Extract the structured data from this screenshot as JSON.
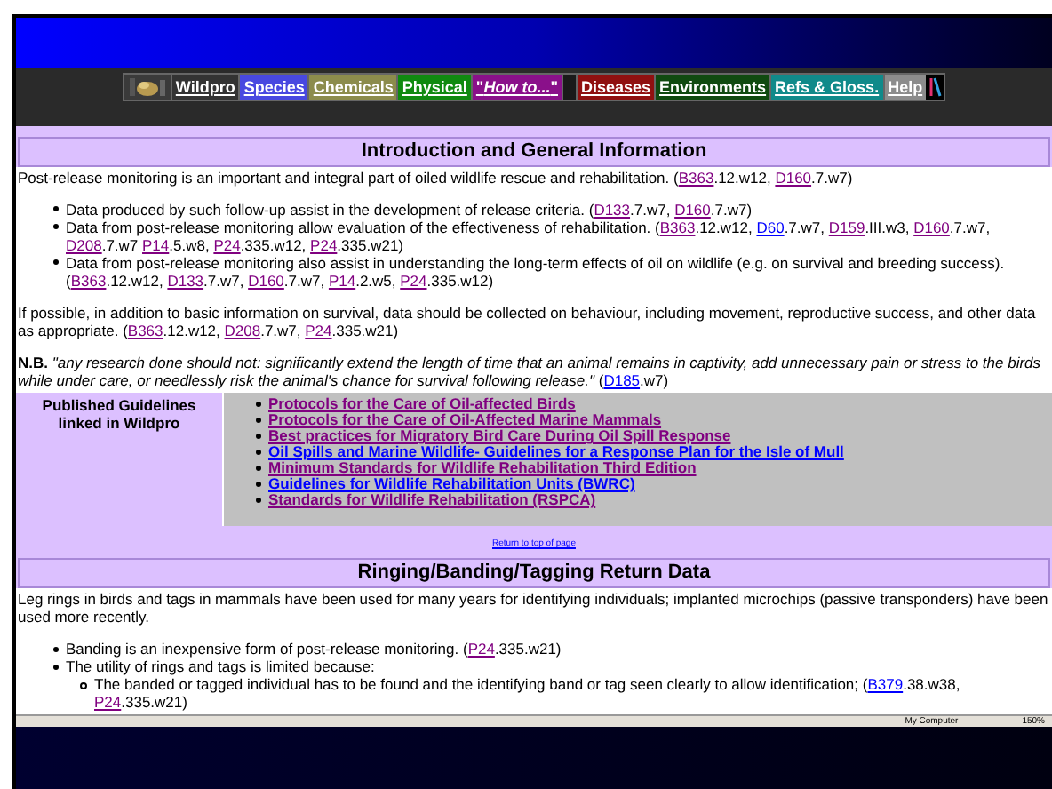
{
  "nav": [
    {
      "kind": "logo"
    },
    {
      "kind": "item",
      "label": "Wildpro",
      "color": "#333333"
    },
    {
      "kind": "item",
      "label": "Species",
      "color": "#4848e0"
    },
    {
      "kind": "item",
      "label": "Chemicals",
      "color": "#8c8c4c"
    },
    {
      "kind": "item",
      "label": "Physical",
      "color": "#108a10"
    },
    {
      "kind": "item",
      "label": "\"*How to...*\"",
      "color": "#8a108a"
    },
    {
      "kind": "gap"
    },
    {
      "kind": "item",
      "label": "Diseases",
      "color": "#901010"
    },
    {
      "kind": "item",
      "label": "Environments",
      "color": "#104a10"
    },
    {
      "kind": "item",
      "label": "Refs & Gloss.",
      "color": "#108a8a"
    },
    {
      "kind": "item",
      "label": "Help",
      "color": "#8c8c8c"
    },
    {
      "kind": "emblem"
    }
  ],
  "intro": {
    "heading": "Introduction and General Information",
    "blocks": [
      {
        "kind": "para",
        "parts": [
          {
            "kind": "text",
            "text": "Post-release monitoring is an important and integral part of oiled wildlife rescue and rehabilitation. ("
          },
          {
            "kind": "link",
            "text": "B363",
            "visited": true
          },
          {
            "kind": "text",
            "text": ".12.w12, "
          },
          {
            "kind": "link",
            "text": "D160",
            "visited": true
          },
          {
            "kind": "text",
            "text": ".7.w7)"
          }
        ]
      },
      {
        "kind": "list",
        "items": [
          {
            "parts": [
              {
                "kind": "text",
                "text": "Data produced by such follow-up assist in the development of release criteria. ("
              },
              {
                "kind": "link",
                "text": "D133",
                "visited": true
              },
              {
                "kind": "text",
                "text": ".7.w7, "
              },
              {
                "kind": "link",
                "text": "D160",
                "visited": true
              },
              {
                "kind": "text",
                "text": ".7.w7)"
              }
            ]
          },
          {
            "parts": [
              {
                "kind": "text",
                "text": "Data from post-release monitoring allow evaluation of the effectiveness of rehabilitation. ("
              },
              {
                "kind": "link",
                "text": "B363",
                "visited": true
              },
              {
                "kind": "text",
                "text": ".12.w12, "
              },
              {
                "kind": "link",
                "text": "D60",
                "visited": false
              },
              {
                "kind": "text",
                "text": ".7.w7, "
              },
              {
                "kind": "link",
                "text": "D159",
                "visited": true
              },
              {
                "kind": "text",
                "text": ".III.w3, "
              },
              {
                "kind": "link",
                "text": "D160",
                "visited": true
              },
              {
                "kind": "text",
                "text": ".7.w7, "
              },
              {
                "kind": "link",
                "text": "D208",
                "visited": true
              },
              {
                "kind": "text",
                "text": ".7.w7 "
              },
              {
                "kind": "link",
                "text": "P14",
                "visited": true
              },
              {
                "kind": "text",
                "text": ".5.w8, "
              },
              {
                "kind": "link",
                "text": "P24",
                "visited": true
              },
              {
                "kind": "text",
                "text": ".335.w12, "
              },
              {
                "kind": "link",
                "text": "P24",
                "visited": true
              },
              {
                "kind": "text",
                "text": ".335.w21)"
              }
            ]
          },
          {
            "parts": [
              {
                "kind": "text",
                "text": "Data from post-release monitoring also assist in understanding the long-term effects of oil on wildlife (e.g. on survival and breeding success). ("
              },
              {
                "kind": "link",
                "text": "B363",
                "visited": true
              },
              {
                "kind": "text",
                "text": ".12.w12, "
              },
              {
                "kind": "link",
                "text": "D133",
                "visited": true
              },
              {
                "kind": "text",
                "text": ".7.w7, "
              },
              {
                "kind": "link",
                "text": "D160",
                "visited": true
              },
              {
                "kind": "text",
                "text": ".7.w7, "
              },
              {
                "kind": "link",
                "text": "P14",
                "visited": true
              },
              {
                "kind": "text",
                "text": ".2.w5, "
              },
              {
                "kind": "link",
                "text": "P24",
                "visited": true
              },
              {
                "kind": "text",
                "text": ".335.w12)"
              }
            ]
          }
        ]
      },
      {
        "kind": "para",
        "parts": [
          {
            "kind": "text",
            "text": "If possible, in addition to basic information on survival, data should be collected on behaviour, including movement, reproductive success, and other data as appropriate. ("
          },
          {
            "kind": "link",
            "text": "B363",
            "visited": true
          },
          {
            "kind": "text",
            "text": ".12.w12, "
          },
          {
            "kind": "link",
            "text": "D208",
            "visited": true
          },
          {
            "kind": "text",
            "text": ".7.w7, "
          },
          {
            "kind": "link",
            "text": "P24",
            "visited": true
          },
          {
            "kind": "text",
            "text": ".335.w21)"
          }
        ]
      },
      {
        "kind": "para",
        "parts": [
          {
            "kind": "text",
            "text": "**N.B.** *\"any research done should not: significantly extend the length of time that an animal remains in captivity, add unnecessary pain or stress to the birds while under care, or needlessly risk the animal's chance for survival following release.\"* ("
          },
          {
            "kind": "link",
            "text": "D185",
            "visited": false
          },
          {
            "kind": "text",
            "text": ".w7)"
          }
        ]
      }
    ]
  },
  "guidelines": {
    "label": "Published Guidelines linked in Wildpro",
    "links": [
      {
        "text": "Protocols for the Care of Oil-affected Birds",
        "visited": true
      },
      {
        "text": "Protocols for the Care of Oil-Affected Marine Mammals",
        "visited": true
      },
      {
        "text": "Best practices for Migratory Bird Care During Oil Spill Response",
        "visited": true
      },
      {
        "text": "Oil Spills and Marine Wildlife- Guidelines for a Response Plan for the Isle of Mull",
        "visited": false
      },
      {
        "text": "Minimum Standards for Wildlife Rehabilitation Third Edition",
        "visited": true
      },
      {
        "text": "Guidelines for Wildlife Rehabilitation Units (BWRC)",
        "visited": false
      },
      {
        "text": "Standards for Wildlife Rehabilitation (RSPCA)",
        "visited": true
      }
    ]
  },
  "return_link": "Return to top of page",
  "ringing": {
    "heading": "Ringing/Banding/Tagging Return Data",
    "blocks": [
      {
        "kind": "para",
        "parts": [
          {
            "kind": "text",
            "text": "Leg rings in birds and tags in mammals have been used for many years for identifying individuals; implanted microchips (passive transponders) have been used more recently."
          }
        ]
      },
      {
        "kind": "list",
        "items": [
          {
            "parts": [
              {
                "kind": "text",
                "text": "Banding is an inexpensive form of post-release monitoring. ("
              },
              {
                "kind": "link",
                "text": "P24",
                "visited": true
              },
              {
                "kind": "text",
                "text": ".335.w21)"
              }
            ]
          },
          {
            "parts": [
              {
                "kind": "text",
                "text": "The utility of rings and tags is limited because:"
              }
            ],
            "children": [
              {
                "parts": [
                  {
                    "kind": "text",
                    "text": "The banded or tagged individual has to be found and the identifying band or tag seen clearly to allow identification; ("
                  },
                  {
                    "kind": "link",
                    "text": "B379",
                    "visited": false
                  },
                  {
                    "kind": "text",
                    "text": ".38.w38, "
                  },
                  {
                    "kind": "link",
                    "text": "P24",
                    "visited": true
                  },
                  {
                    "kind": "text",
                    "text": ".335.w21)"
                  }
                ]
              }
            ]
          }
        ]
      }
    ]
  },
  "status_bar": {
    "zone": "My Computer",
    "zoom": "150%"
  }
}
